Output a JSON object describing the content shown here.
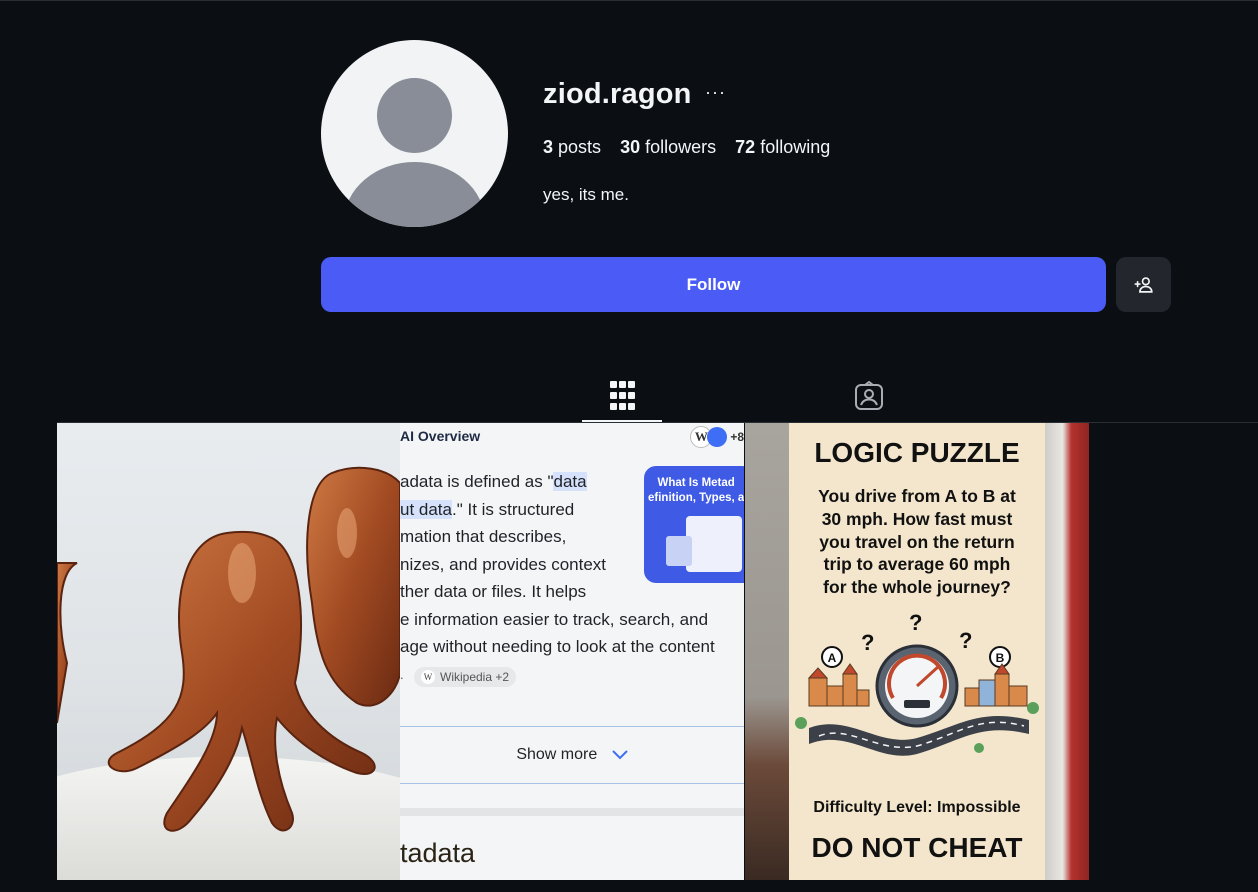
{
  "profile": {
    "username": "ziod.ragon",
    "more": "···",
    "bio": "yes, its me.",
    "stats": {
      "posts_count": "3",
      "posts_label": "posts",
      "followers_count": "30",
      "followers_label": "followers",
      "following_count": "72",
      "following_label": "following"
    }
  },
  "actions": {
    "follow_label": "Follow"
  },
  "tabs": [
    {
      "name": "posts-grid",
      "icon": "grid-icon",
      "active": true
    },
    {
      "name": "tagged",
      "icon": "user-tag-icon",
      "active": false
    }
  ],
  "posts": {
    "post2": {
      "overview_title": "AI Overview",
      "badge_count": "+8",
      "line1a": "adata is defined as \"",
      "line1b": "data",
      "line2a": "ut data",
      "line2b": ".\" It is structured",
      "line3": "mation that describes,",
      "line4": "nizes, and provides context",
      "line5": "ther data or files. It helps",
      "line6": "e information easier to track, search, and",
      "line7": "age without needing to look at the content",
      "card_title": "What Is Metad\nefinition, Types, a",
      "source_chip": "Wikipedia +2",
      "show_more": "Show more",
      "footer_heading": "tadata"
    },
    "post3": {
      "title": "LOGIC PUZZLE",
      "question": "You drive from A to B at\n30 mph. How fast must\nyou travel on the return\ntrip to average 60 mph\nfor the whole journey?",
      "difficulty": "Difficulty Level: Impossible",
      "warning": "DO NOT CHEAT",
      "point_a": "A",
      "point_b": "B"
    }
  },
  "colors": {
    "background": "#0b0f14",
    "accent": "#4a5cf5",
    "secondary_button": "#23272d"
  }
}
